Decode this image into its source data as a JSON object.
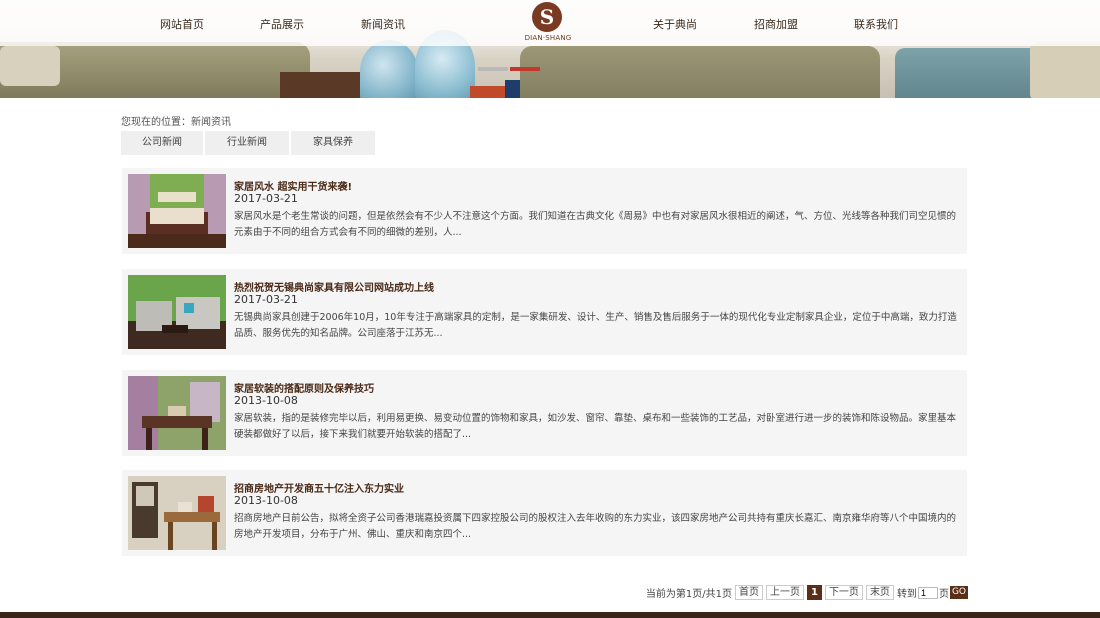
{
  "nav": {
    "items": [
      "网站首页",
      "产品展示",
      "新闻资讯",
      "关于典尚",
      "招商加盟",
      "联系我们"
    ],
    "logo_text": "DIAN·SHANG"
  },
  "banner": {
    "slides_count": 2,
    "active_slide": 2,
    "active_color": "#c0392b",
    "inactive_color": "#b9b9b9"
  },
  "breadcrumb": "您现在的位置：新闻资讯",
  "tabs": [
    "公司新闻",
    "行业新闻",
    "家具保养"
  ],
  "news": [
    {
      "title": "家居风水 超实用干货来袭!",
      "date": "2017-03-21",
      "desc": "家居风水是个老生常谈的问题，但是依然会有不少人不注意这个方面。我们知道在古典文化《周易》中也有对家居风水很相近的阐述，气、方位、光线等各种我们司空见惯的元素由于不同的组合方式会有不同的细微的差别，人..."
    },
    {
      "title": "热烈祝贺无锡典尚家具有限公司网站成功上线",
      "date": "2017-03-21",
      "desc": "无锡典尚家具创建于2006年10月，10年专注于高端家具的定制，是一家集研发、设计、生产、销售及售后服务于一体的现代化专业定制家具企业，定位于中高端，致力打造品质、服务优先的知名品牌。公司座落于江苏无..."
    },
    {
      "title": "家居软装的搭配原则及保养技巧",
      "date": "2013-10-08",
      "desc": "家居软装，指的是装修完毕以后，利用易更换、易变动位置的饰物和家具，如沙发、窗帘、靠垫、桌布和一些装饰的工艺品，对卧室进行进一步的装饰和陈设物品。家里基本硬装都做好了以后，接下来我们就要开始软装的搭配了..."
    },
    {
      "title": "招商房地产开发商五十亿注入东力实业",
      "date": "2013-10-08",
      "desc": "招商房地产日前公告，拟将全资子公司香港瑞嘉投资属下四家控股公司的股权注入去年收购的东力实业，该四家房地产公司共持有重庆长嘉汇、南京雍华府等八个中国境内的房地产开发项目，分布于广州、佛山、重庆和南京四个..."
    }
  ],
  "pager": {
    "info": "当前为第1页/共1页",
    "first": "首页",
    "prev": "上一页",
    "current": "1",
    "next": "下一页",
    "last": "末页",
    "goto_label": "转到",
    "goto_value": "1",
    "page_unit": "页",
    "go": "GO"
  }
}
